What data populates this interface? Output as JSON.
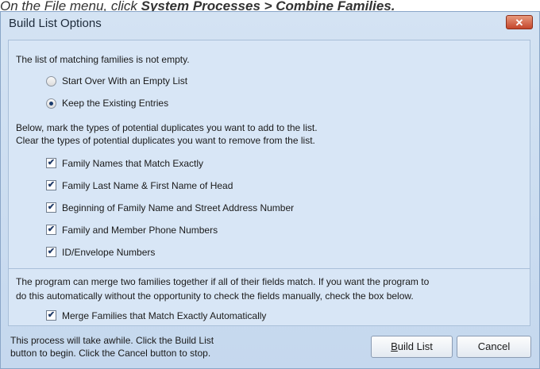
{
  "caption": {
    "prefix": "On the File menu, click ",
    "path": "System Processes > Combine Families."
  },
  "window": {
    "title": "Build List Options",
    "close_glyph": "✕"
  },
  "status": {
    "intro": "The list of matching families is not empty."
  },
  "radios": [
    {
      "label": "Start Over With an Empty List",
      "selected": false
    },
    {
      "label": "Keep the Existing Entries",
      "selected": true
    }
  ],
  "instructions": {
    "line1": "Below, mark the types of potential duplicates you want to add to the list.",
    "line2": "Clear the types of potential duplicates you want to remove from the list."
  },
  "checkboxes": [
    {
      "label": "Family Names that Match Exactly",
      "checked": true
    },
    {
      "label": "Family Last Name & First Name of Head",
      "checked": true
    },
    {
      "label": "Beginning of Family Name and Street Address Number",
      "checked": true
    },
    {
      "label": "Family and Member Phone Numbers",
      "checked": true
    },
    {
      "label": "ID/Envelope Numbers",
      "checked": true
    }
  ],
  "merge": {
    "line1": "The program can merge two families together if all of their fields match. If you want the program to",
    "line2": "do this automatically without the opportunity to check the fields manually, check the box below.",
    "checkbox_label": "Merge Families that Match Exactly Automatically",
    "checked": true
  },
  "footer": {
    "line1": "This process will take awhile. Click the Build List",
    "line2": "button to begin. Click the Cancel button to stop.",
    "build_label": "Build List",
    "cancel_label": "Cancel"
  },
  "icons": {
    "checkmark": "✔"
  }
}
